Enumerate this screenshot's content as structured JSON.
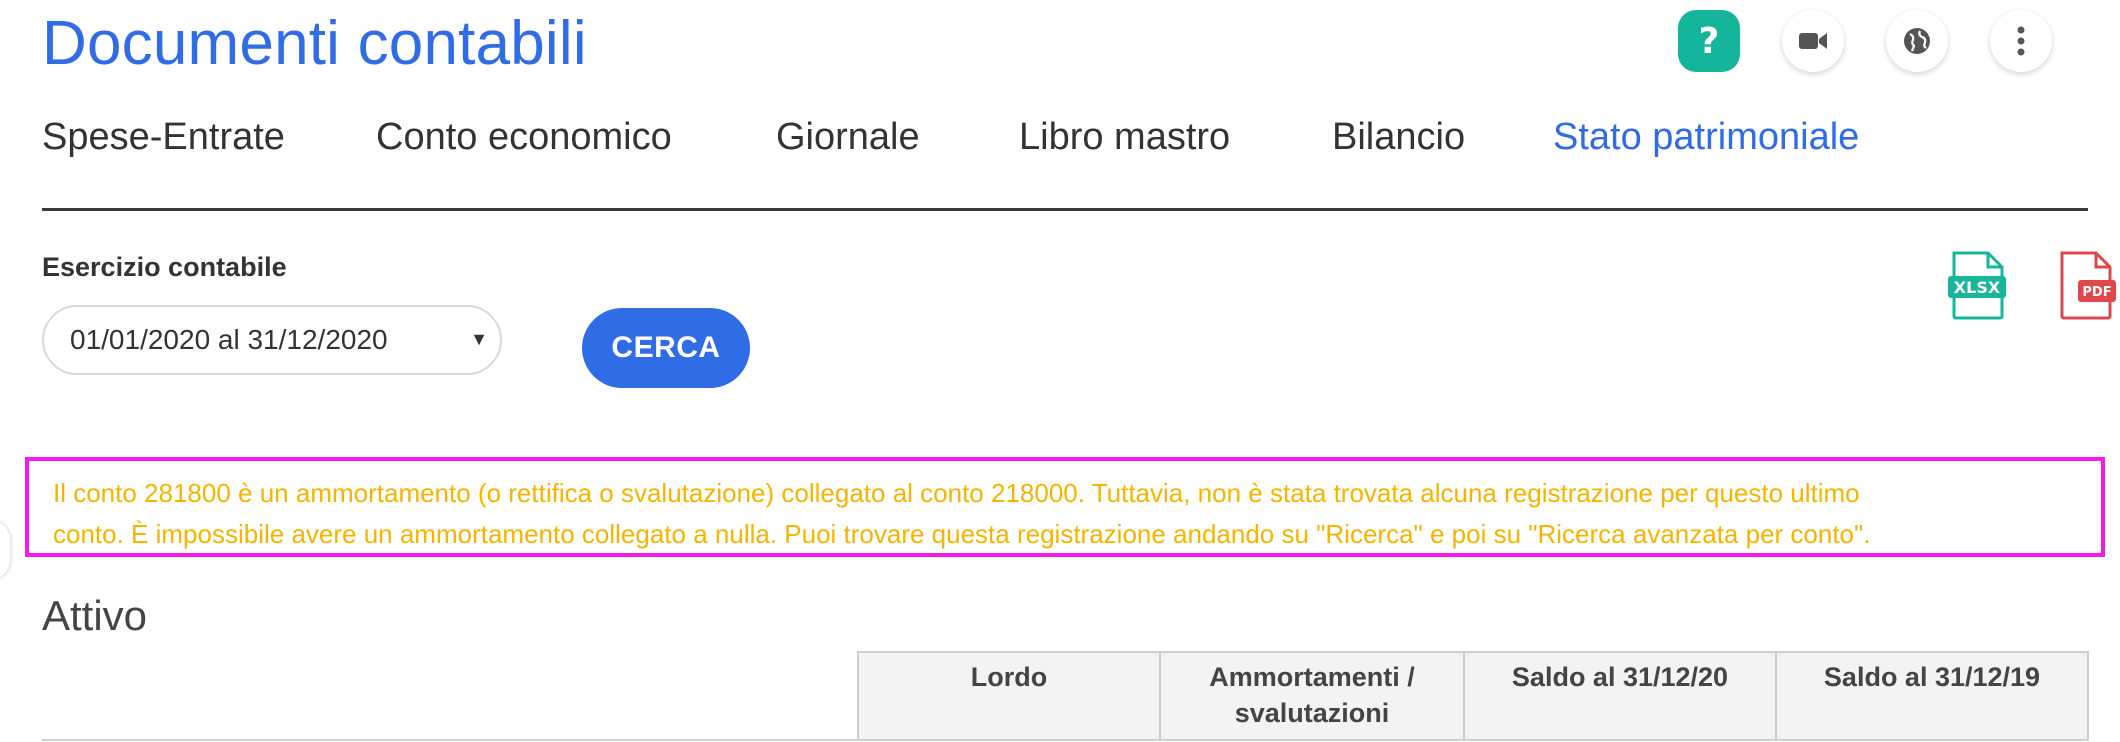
{
  "header": {
    "title": "Documenti contabili",
    "help_label": "?",
    "icons": [
      "help-icon",
      "video-camera-icon",
      "globe-icon",
      "more-vertical-icon"
    ]
  },
  "tabs": [
    {
      "label": "Spese-Entrate",
      "active": false
    },
    {
      "label": "Conto economico",
      "active": false
    },
    {
      "label": "Giornale",
      "active": false
    },
    {
      "label": "Libro mastro",
      "active": false
    },
    {
      "label": "Bilancio",
      "active": false
    },
    {
      "label": "Stato patrimoniale",
      "active": true
    }
  ],
  "filters": {
    "esercizio_label": "Esercizio contabile",
    "esercizio_value": "01/01/2020 al 31/12/2020",
    "search_button": "CERCA"
  },
  "exports": {
    "xlsx_label": "XLSX",
    "pdf_label": "PDF"
  },
  "alert": {
    "line1": "Il conto 281800 è un ammortamento (o rettifica o svalutazione) collegato al conto 218000. Tuttavia, non è stata trovata alcuna registrazione per questo ultimo",
    "line2": "conto. È impossibile avere un ammortamento collegato a nulla. Puoi trovare questa registrazione andando su \"Ricerca\" e poi su \"Ricerca avanzata per conto\"."
  },
  "attivo": {
    "title": "Attivo",
    "columns": [
      "",
      "Lordo",
      "Ammortamenti / svalutazioni",
      "Saldo al 31/12/20",
      "Saldo al 31/12/19"
    ]
  },
  "colors": {
    "accent": "#2f6ce6",
    "help_green": "#15b59b",
    "alert_text": "#f5b400",
    "alert_border": "#f21ce6",
    "xlsx_green": "#17b59a",
    "pdf_red": "#e0474c"
  }
}
